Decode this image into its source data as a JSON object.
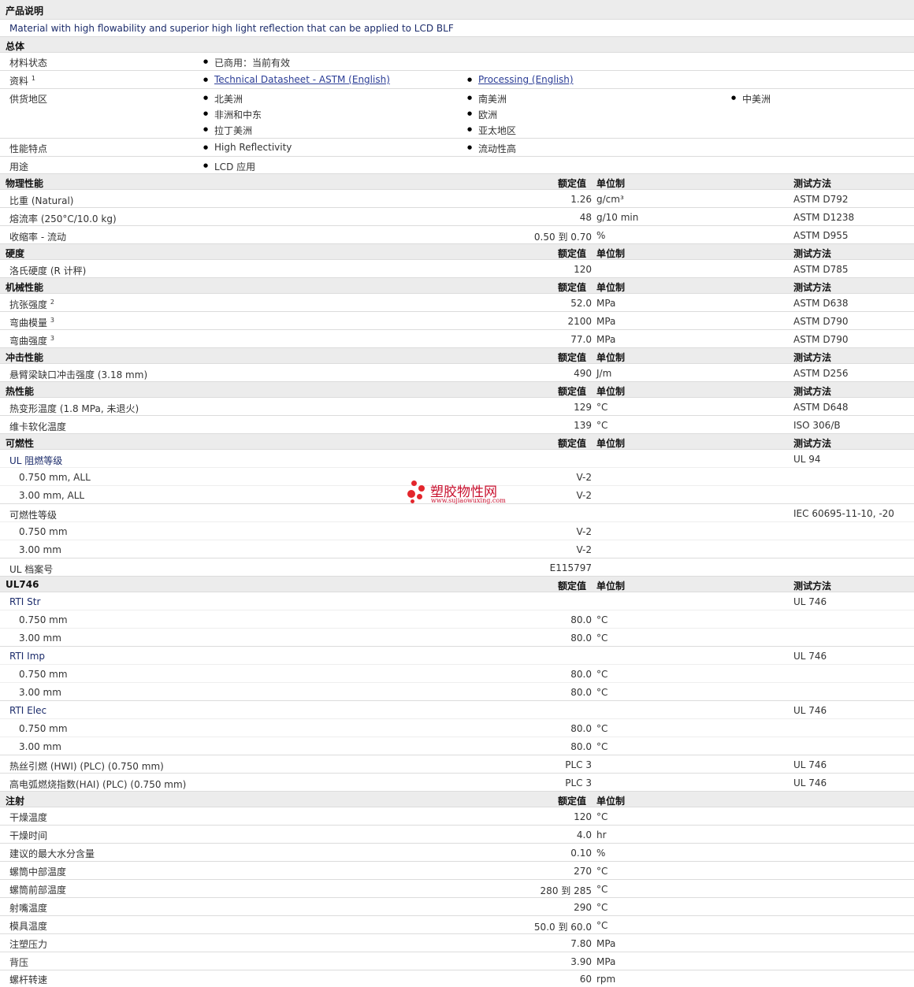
{
  "header": {
    "product_title": "产品说明",
    "product_desc": "Material with high flowability and superior high light reflection that can be applied to LCD BLF",
    "general_title": "总体"
  },
  "general": {
    "material_status_label": "材料状态",
    "material_status_value": "已商用：当前有效",
    "documents_label": "资料",
    "documents_sup": "1",
    "doc_link_1": "Technical Datasheet - ASTM (English)",
    "doc_link_2": "Processing (English)",
    "supply_label": "供货地区",
    "supply_regions": [
      "北美洲",
      "南美洲",
      "中美洲",
      "非洲和中东",
      "欧洲",
      "拉丁美洲",
      "亚太地区"
    ],
    "features_label": "性能特点",
    "feature_1": "High Reflectivity",
    "feature_2": "流动性高",
    "uses_label": "用途",
    "use_1": "LCD 应用"
  },
  "cols": {
    "nominal": "额定值",
    "unit": "单位制",
    "method": "测试方法"
  },
  "physical": {
    "title": "物理性能",
    "r1": {
      "name": "比重",
      "cond": "(Natural)",
      "value": "1.26",
      "unit": "g/cm³",
      "method": "ASTM D792"
    },
    "r2": {
      "name": "熔流率",
      "cond": "(250°C/10.0 kg)",
      "value": "48",
      "unit": "g/10 min",
      "method": "ASTM D1238"
    },
    "r3": {
      "name": "收缩率",
      "cond": "- 流动",
      "value": "0.50 到  0.70",
      "unit": "%",
      "method": "ASTM D955"
    }
  },
  "hardness": {
    "title": "硬度",
    "r1": {
      "name": "洛氏硬度",
      "cond": "(R 计秤)",
      "value": "120",
      "method": "ASTM D785"
    }
  },
  "mechanical": {
    "title": "机械性能",
    "r1": {
      "name": "抗张强度",
      "sup": "2",
      "value": "52.0",
      "unit": "MPa",
      "method": "ASTM D638"
    },
    "r2": {
      "name": "弯曲模量",
      "sup": "3",
      "value": "2100",
      "unit": "MPa",
      "method": "ASTM D790"
    },
    "r3": {
      "name": "弯曲强度",
      "sup": "3",
      "value": "77.0",
      "unit": "MPa",
      "method": "ASTM D790"
    }
  },
  "impact": {
    "title": "冲击性能",
    "r1": {
      "name": "悬臂梁缺口冲击强度",
      "cond": "(3.18 mm)",
      "value": "490",
      "unit": "J/m",
      "method": "ASTM D256"
    }
  },
  "thermal": {
    "title": "热性能",
    "r1": {
      "name": "热变形温度",
      "cond": "(1.8 MPa, 未退火)",
      "value": "129",
      "unit": "°C",
      "method": "ASTM D648"
    },
    "r2": {
      "name": "维卡软化温度",
      "value": "139",
      "unit": "°C",
      "method": "ISO 306/B"
    }
  },
  "flammability": {
    "title": "可燃性",
    "ul_label": "UL 阻燃等级",
    "ul_method": "UL 94",
    "ul_r1_label": "0.750 mm, ALL",
    "ul_r1_value": "V-2",
    "ul_r2_label": "3.00 mm, ALL",
    "ul_r2_value": "V-2",
    "flam_label": "可燃性等级",
    "flam_method": "IEC 60695-11-10, -20",
    "flam_r1_label": "0.750 mm",
    "flam_r1_value": "V-2",
    "flam_r2_label": "3.00 mm",
    "flam_r2_value": "V-2",
    "file_label": "UL 档案号",
    "file_value": "E115797"
  },
  "ul746": {
    "title": "UL746",
    "str_label": "RTI Str",
    "imp_label": "RTI Imp",
    "elec_label": "RTI Elec",
    "method": "UL 746",
    "t1": "0.750 mm",
    "t2": "3.00 mm",
    "val": "80.0",
    "unit": "°C",
    "hwi_label": "热丝引燃 (HWI) (PLC) (0.750 mm)",
    "hwi_value": "PLC 3",
    "hai_label": "高电弧燃烧指数(HAI) (PLC) (0.750 mm)",
    "hai_value": "PLC 3"
  },
  "injection": {
    "title": "注射",
    "r1": {
      "name": "干燥温度",
      "value": "120",
      "unit": "°C"
    },
    "r2": {
      "name": "干燥时间",
      "value": "4.0",
      "unit": "hr"
    },
    "r3": {
      "name": "建议的最大水分含量",
      "value": "0.10",
      "unit": "%"
    },
    "r4": {
      "name": "螺筒中部温度",
      "value": "270",
      "unit": "°C"
    },
    "r5": {
      "name": "螺筒前部温度",
      "value": "280 到  285",
      "unit": "°C"
    },
    "r6": {
      "name": "射嘴温度",
      "value": "290",
      "unit": "°C"
    },
    "r7": {
      "name": "模具温度",
      "value": "50.0 到  60.0",
      "unit": "°C"
    },
    "r8": {
      "name": "注塑压力",
      "value": "7.80",
      "unit": "MPa"
    },
    "r9": {
      "name": "背压",
      "value": "3.90",
      "unit": "MPa"
    },
    "r10": {
      "name": "螺杆转速",
      "value": "60",
      "unit": "rpm"
    }
  },
  "watermark": {
    "brand": "塑胶物性网",
    "url": "www.sujiaowuxing.com"
  }
}
